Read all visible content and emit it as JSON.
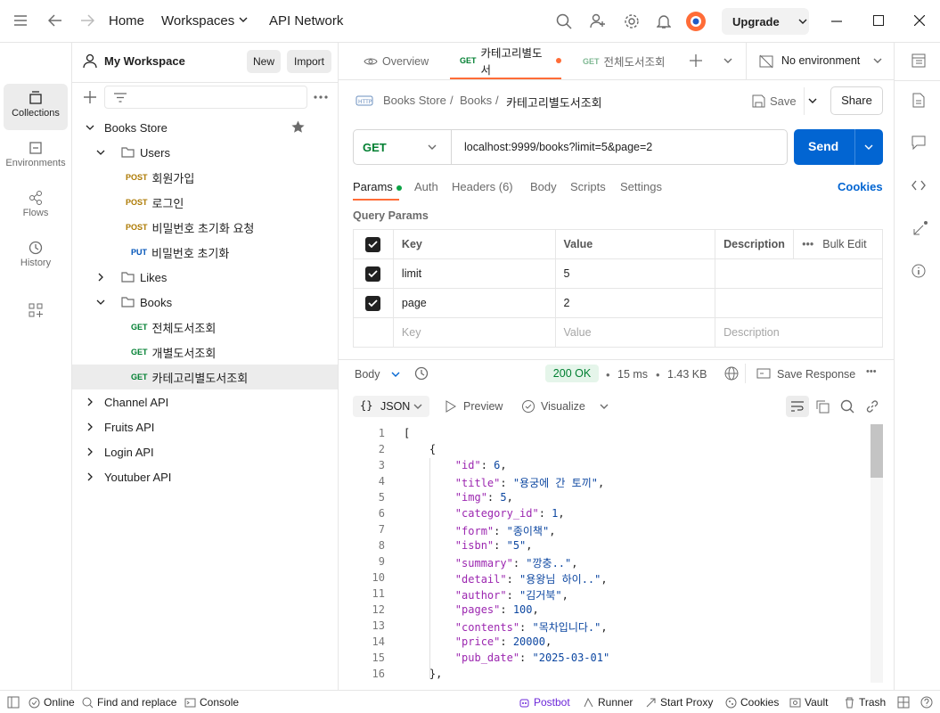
{
  "titlebar": {
    "nav": [
      "Home",
      "Workspaces",
      "API Network"
    ],
    "upgrade": "Upgrade"
  },
  "rail": [
    {
      "label": "Collections"
    },
    {
      "label": "Environments"
    },
    {
      "label": "Flows"
    },
    {
      "label": "History"
    }
  ],
  "sidebar": {
    "workspace": "My Workspace",
    "new_label": "New",
    "import_label": "Import",
    "tree": [
      {
        "label": "Books Store"
      },
      {
        "label": "Users"
      },
      {
        "method": "POST",
        "label": "회원가입"
      },
      {
        "method": "POST",
        "label": "로그인"
      },
      {
        "method": "POST",
        "label": "비밀번호 초기화 요청"
      },
      {
        "method": "PUT",
        "label": "비밀번호 초기화"
      },
      {
        "label": "Likes"
      },
      {
        "label": "Books"
      },
      {
        "method": "GET",
        "label": "전체도서조회"
      },
      {
        "method": "GET",
        "label": "개별도서조회"
      },
      {
        "method": "GET",
        "label": "카테고리별도서조회"
      },
      {
        "label": "Channel API"
      },
      {
        "label": "Fruits API"
      },
      {
        "label": "Login API"
      },
      {
        "label": "Youtuber API"
      }
    ]
  },
  "tabs": {
    "overview": "Overview",
    "tab1_method": "GET",
    "tab1_label": "카테고리별도서",
    "tab2_method": "GET",
    "tab2_label": "전체도서조회",
    "environment": "No environment"
  },
  "request": {
    "breadcrumb": [
      "Books Store",
      "Books",
      "카테고리별도서조회"
    ],
    "save_label": "Save",
    "share_label": "Share",
    "method": "GET",
    "url": "localhost:9999/books?limit=5&page=2",
    "send_label": "Send",
    "subtabs": [
      "Params",
      "Auth",
      "Headers (6)",
      "Body",
      "Scripts",
      "Settings"
    ],
    "cookies_label": "Cookies",
    "query_params_title": "Query Params",
    "columns": [
      "Key",
      "Value",
      "Description"
    ],
    "bulk_edit": "Bulk Edit",
    "params": [
      {
        "key": "limit",
        "value": "5",
        "checked": true
      },
      {
        "key": "page",
        "value": "2",
        "checked": true
      }
    ],
    "placeholders": {
      "key": "Key",
      "value": "Value",
      "description": "Description"
    }
  },
  "response": {
    "body_label": "Body",
    "status": "200 OK",
    "time": "15 ms",
    "size": "1.43 KB",
    "save_response": "Save Response",
    "format": "JSON",
    "preview": "Preview",
    "visualize": "Visualize",
    "lines": [
      "[",
      "    {",
      "        \"id\": 6,",
      "        \"title\": \"용궁에 간 토끼\",",
      "        \"img\": 5,",
      "        \"category_id\": 1,",
      "        \"form\": \"종이책\",",
      "        \"isbn\": \"5\",",
      "        \"summary\": \"깡충..\",",
      "        \"detail\": \"용왕님 하이..\",",
      "        \"author\": \"김거북\",",
      "        \"pages\": 100,",
      "        \"contents\": \"목차입니다.\",",
      "        \"price\": 20000,",
      "        \"pub_date\": \"2025-03-01\"",
      "    },"
    ]
  },
  "statusbar": {
    "online": "Online",
    "find_replace": "Find and replace",
    "console": "Console",
    "postbot": "Postbot",
    "runner": "Runner",
    "start_proxy": "Start Proxy",
    "cookies": "Cookies",
    "vault": "Vault",
    "trash": "Trash"
  },
  "colors": {
    "accent": "#ff6c37",
    "send": "#0265d2",
    "get": "#007f31",
    "post": "#ad7a03",
    "put": "#0053b8"
  }
}
